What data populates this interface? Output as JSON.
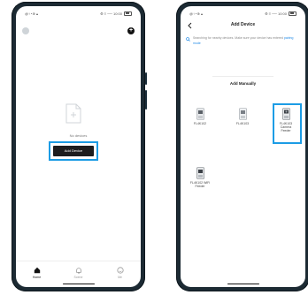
{
  "status_bar": {
    "left_text": "@↑◔⊕ ▴",
    "right_text": "⚙ ≡ ── 10:00"
  },
  "home_screen": {
    "empty_message": "No devices",
    "add_device_label": "Add Device",
    "tabs": [
      {
        "label": "Home",
        "icon": "home-icon",
        "active": true
      },
      {
        "label": "Scene",
        "icon": "bell-icon",
        "active": false
      },
      {
        "label": "Me",
        "icon": "smile-icon",
        "active": false
      }
    ],
    "highlight_color": "#1c9ce5"
  },
  "add_device_screen": {
    "title": "Add Device",
    "search_text": "Searching for nearby devices. Make sure your device has entered",
    "search_link": "pairing mode",
    "section_title": "Add Manually",
    "devices": [
      {
        "name": "FL4K102",
        "highlighted": false
      },
      {
        "name": "FL4K103",
        "highlighted": false
      },
      {
        "name": "FL4K103 Camera Feeder",
        "highlighted": true
      },
      {
        "name": "FL4K102 WiFi Feeder",
        "highlighted": false
      }
    ],
    "accent_color": "#1c9ce5",
    "link_color": "#1e88e5"
  }
}
